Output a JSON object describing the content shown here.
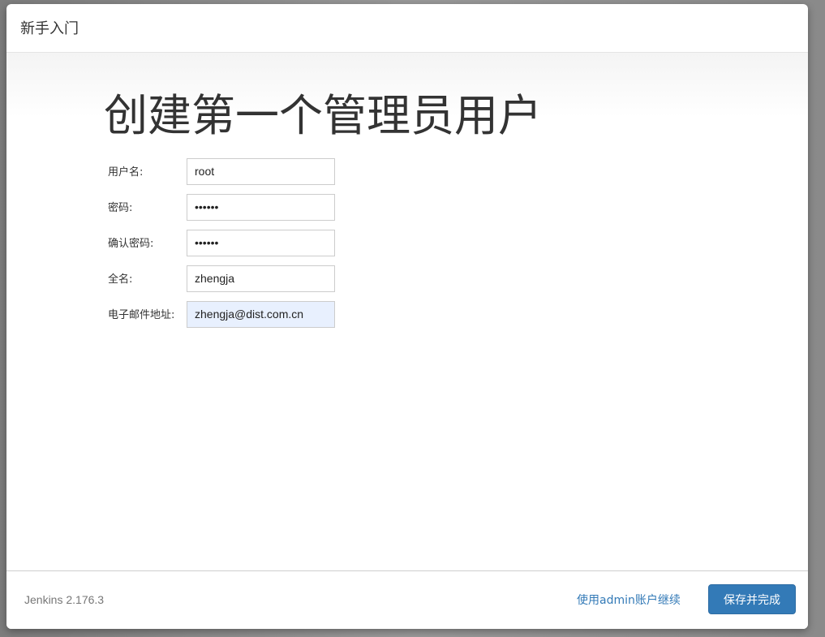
{
  "dialog": {
    "title": "新手入门"
  },
  "main": {
    "heading": "创建第一个管理员用户",
    "fields": [
      {
        "label": "用户名:",
        "value": "root",
        "type": "text"
      },
      {
        "label": "密码:",
        "value": "••••••",
        "type": "password"
      },
      {
        "label": "确认密码:",
        "value": "••••••",
        "type": "password"
      },
      {
        "label": "全名:",
        "value": "zhengja",
        "type": "text"
      },
      {
        "label": "电子邮件地址:",
        "value": "zhengja@dist.com.cn",
        "type": "email"
      }
    ]
  },
  "footer": {
    "version": "Jenkins 2.176.3",
    "skip_link": "使用admin账户继续",
    "save_label": "保存并完成"
  },
  "colors": {
    "primary": "#337ab7",
    "autofill": "#e8f0fe"
  }
}
